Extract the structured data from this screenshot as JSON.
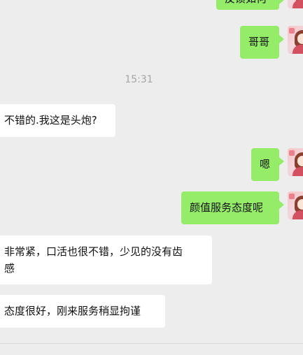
{
  "timestamp": "15:31",
  "messages": [
    {
      "text": "反馈如何"
    },
    {
      "text": "哥哥"
    },
    {
      "text": "不错的.我这是头炮?"
    },
    {
      "text": "嗯"
    },
    {
      "text": "颜值服务态度呢"
    },
    {
      "text": "非常紧，口活也很不错，少见的没有齿\n感"
    },
    {
      "text": "态度很好，刚来服务稍显拘谨"
    }
  ],
  "colors": {
    "background": "#ededed",
    "sent_bubble": "#95ec69",
    "received_bubble": "#ffffff",
    "timestamp_text": "#a5a5a5"
  },
  "icons": [
    "user-avatar"
  ]
}
